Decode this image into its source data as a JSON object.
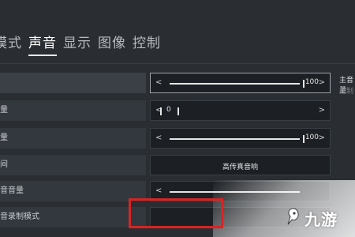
{
  "tabs": [
    {
      "label": "模式"
    },
    {
      "label": "声音"
    },
    {
      "label": "显示"
    },
    {
      "label": "图像"
    },
    {
      "label": "控制"
    }
  ],
  "active_tab": "声音",
  "rows": [
    {
      "label": "",
      "type": "slider",
      "value": "100",
      "fill": 1.0
    },
    {
      "label": "量",
      "type": "slider",
      "value": "0",
      "fill": 0.0
    },
    {
      "label": "量",
      "type": "slider",
      "value": "100",
      "fill": 1.0
    },
    {
      "label": "间",
      "type": "select",
      "value": "高传真音响"
    },
    {
      "label": "音音量",
      "type": "slider",
      "value": "",
      "fill": 1.0
    },
    {
      "label": "音录制模式",
      "type": "select",
      "value": ""
    }
  ],
  "side_labels": {
    "primary": "主音量",
    "secondary": "控制"
  },
  "watermark": {
    "text": "九游",
    "icon": "fox-icon"
  },
  "colors": {
    "background": "#2a2e33",
    "highlight": "#d82424"
  }
}
